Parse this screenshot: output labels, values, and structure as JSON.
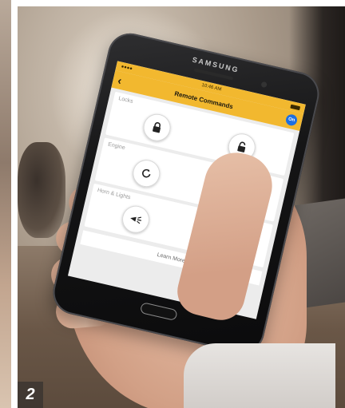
{
  "step_number": "2",
  "phone": {
    "brand": "SAMSUNG"
  },
  "app": {
    "status_time": "10:46 AM",
    "title": "Remote Commands",
    "accent_color": "#f2b82f",
    "hub_badge_color": "#1d6fe0",
    "sections": [
      {
        "label": "Locks",
        "buttons": [
          {
            "icon": "lock-closed-icon"
          },
          {
            "icon": "lock-open-icon"
          }
        ]
      },
      {
        "label": "Engine",
        "buttons": [
          {
            "icon": "remote-start-icon"
          },
          {
            "icon": "remote-stop-icon"
          }
        ]
      },
      {
        "label": "Horn & Lights",
        "buttons": [
          {
            "icon": "horn-icon"
          },
          {
            "icon": "lights-icon"
          }
        ]
      }
    ],
    "learn_more": "Learn More"
  }
}
